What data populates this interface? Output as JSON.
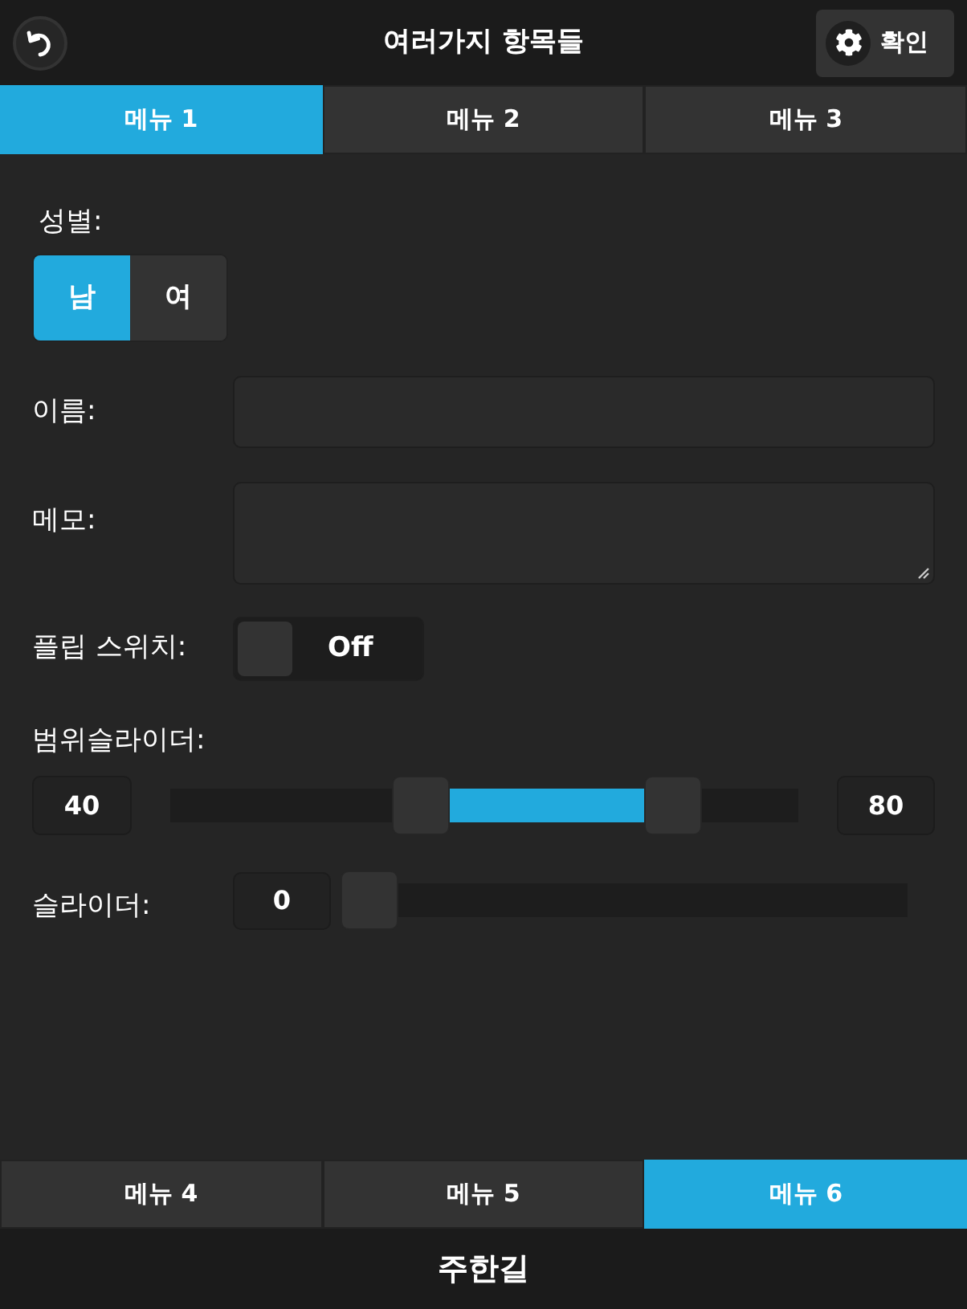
{
  "header": {
    "title": "여러가지 항목들",
    "confirm_button": "확인"
  },
  "top_tabs": [
    {
      "label": "메뉴 1",
      "selected": true
    },
    {
      "label": "메뉴 2",
      "selected": false
    },
    {
      "label": "메뉴 3",
      "selected": false
    }
  ],
  "form": {
    "gender": {
      "label": "성별:",
      "options": [
        {
          "label": "남",
          "selected": true
        },
        {
          "label": "여",
          "selected": false
        }
      ]
    },
    "name": {
      "label": "이름:"
    },
    "memo": {
      "label": "메모:"
    },
    "flip_switch": {
      "label": "플립 스위치:",
      "on": false,
      "state_text": "Off"
    },
    "range_slider": {
      "label": "범위슬라이더:",
      "low": {
        "reading": "40",
        "level": 0.4
      },
      "high": {
        "reading": "80",
        "level": 0.8
      }
    },
    "slider": {
      "label": "슬라이더:",
      "reading": "0",
      "level": 0
    }
  },
  "bottom_tabs": [
    {
      "label": "메뉴 4",
      "selected": false
    },
    {
      "label": "메뉴 5",
      "selected": false
    },
    {
      "label": "메뉴 6",
      "selected": true
    }
  ],
  "footer": {
    "title": "주한길"
  }
}
